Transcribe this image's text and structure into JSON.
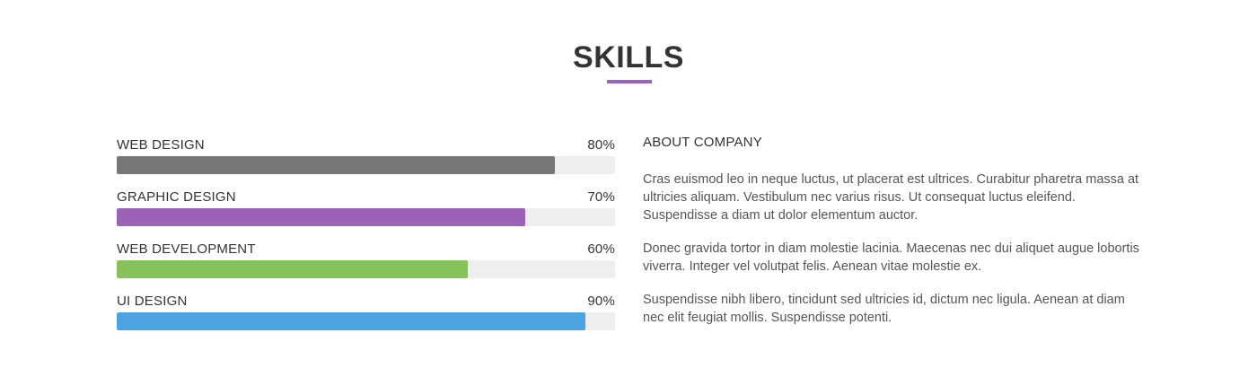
{
  "title": "SKILLS",
  "colors": {
    "accent": "#9b62b8",
    "track": "#eeeeee"
  },
  "skills": [
    {
      "name": "WEB DESIGN",
      "value_label": "80%",
      "percent": 88,
      "color": "#777777"
    },
    {
      "name": "GRAPHIC DESIGN",
      "value_label": "70%",
      "percent": 82,
      "color": "#9b62b8"
    },
    {
      "name": "WEB DEVELOPMENT",
      "value_label": "60%",
      "percent": 70.5,
      "color": "#86c15a"
    },
    {
      "name": "UI DESIGN",
      "value_label": "90%",
      "percent": 94,
      "color": "#4ba3e1"
    }
  ],
  "about": {
    "title": "ABOUT COMPANY",
    "paragraphs": [
      "Cras euismod leo in neque luctus, ut placerat est ultrices. Curabitur pharetra massa at ultricies aliquam. Vestibulum nec varius risus. Ut consequat luctus eleifend. Suspendisse a diam ut dolor elementum auctor.",
      "Donec gravida tortor in diam molestie lacinia. Maecenas nec dui aliquet augue lobortis viverra. Integer vel volutpat felis. Aenean vitae molestie ex.",
      "Suspendisse nibh libero, tincidunt sed ultricies id, dictum nec ligula. Aenean at diam nec elit feugiat mollis. Suspendisse potenti."
    ]
  }
}
